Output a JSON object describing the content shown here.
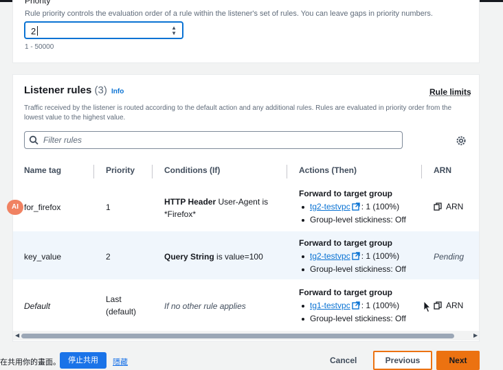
{
  "priority_section": {
    "label": "Priority",
    "description": "Rule priority controls the evaluation order of a rule within the listener's set of rules. You can leave gaps in priority numbers.",
    "value": "2",
    "range_hint": "1 - 50000"
  },
  "listener_rules": {
    "title": "Listener rules",
    "count": "(3)",
    "info": "Info",
    "rule_limits": "Rule limits",
    "description": "Traffic received by the listener is routed according to the default action and any additional rules. Rules are evaluated in priority order from the lowest value to the highest value.",
    "filter_placeholder": "Filter rules",
    "columns": [
      "Name tag",
      "Priority",
      "Conditions (If)",
      "Actions (Then)",
      "ARN"
    ],
    "rows": [
      {
        "name": "for_firefox",
        "priority": "1",
        "cond_bold": "HTTP Header",
        "cond_rest": " User-Agent is",
        "cond_line2": "*Firefox*",
        "action_title": "Forward to target group",
        "target": "tg2-testvpc",
        "target_weight": ": 1 (100%)",
        "stickiness": "Group-level stickiness: Off",
        "arn": "ARN"
      },
      {
        "name": "key_value",
        "priority": "2",
        "cond_bold": "Query String",
        "cond_rest": " is value=100",
        "action_title": "Forward to target group",
        "target": "tg2-testvpc",
        "target_weight": ": 1 (100%)",
        "stickiness": "Group-level stickiness: Off",
        "arn": "Pending"
      },
      {
        "name": "Default",
        "priority_line1": "Last",
        "priority_line2": "(default)",
        "condition": "If no other rule applies",
        "action_title": "Forward to target group",
        "target": "tg1-testvpc",
        "target_weight": ": 1 (100%)",
        "stickiness": "Group-level stickiness: Off",
        "arn": "ARN"
      }
    ]
  },
  "ai_badge": "AI",
  "screen_share": {
    "text": "在共用你的畫面。",
    "stop": "停止共用",
    "hide": "隱藏"
  },
  "footer": {
    "cancel": "Cancel",
    "previous": "Previous",
    "next": "Next"
  },
  "colors": {
    "accent": "#ec7211",
    "link": "#0972d3",
    "focus": "#0972d3"
  }
}
